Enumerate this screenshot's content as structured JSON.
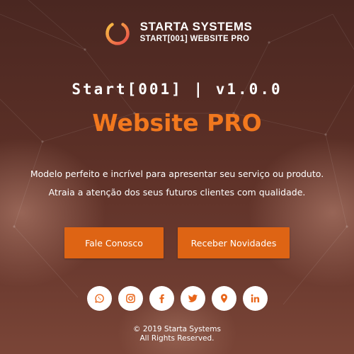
{
  "brand": {
    "name": "STARTA SYSTEMS",
    "subtitle": "START[001] WEBSITE PRO",
    "logo_icon": "power-icon"
  },
  "hero": {
    "version": "Start[001] | v1.0.0",
    "title": "Website PRO",
    "description": "Modelo perfeito e incrível para apresentar seu serviço ou produto. Atraia a atenção dos seus futuros clientes com qualidade."
  },
  "buttons": {
    "contact_label": "Fale Conosco",
    "news_label": "Receber Novidades"
  },
  "social": [
    {
      "icon": "whatsapp-icon"
    },
    {
      "icon": "instagram-icon"
    },
    {
      "icon": "facebook-icon"
    },
    {
      "icon": "twitter-icon"
    },
    {
      "icon": "location-pin-icon"
    },
    {
      "icon": "linkedin-icon"
    }
  ],
  "footer": {
    "copyright": "© 2019 Starta Systems",
    "rights": "All Rights Reserved."
  },
  "colors": {
    "accent": "#f2781e",
    "button": "#de6414",
    "background": "#5a2f26",
    "logo_gradient_start": "#f7c043",
    "logo_gradient_end": "#ec4b4b"
  }
}
